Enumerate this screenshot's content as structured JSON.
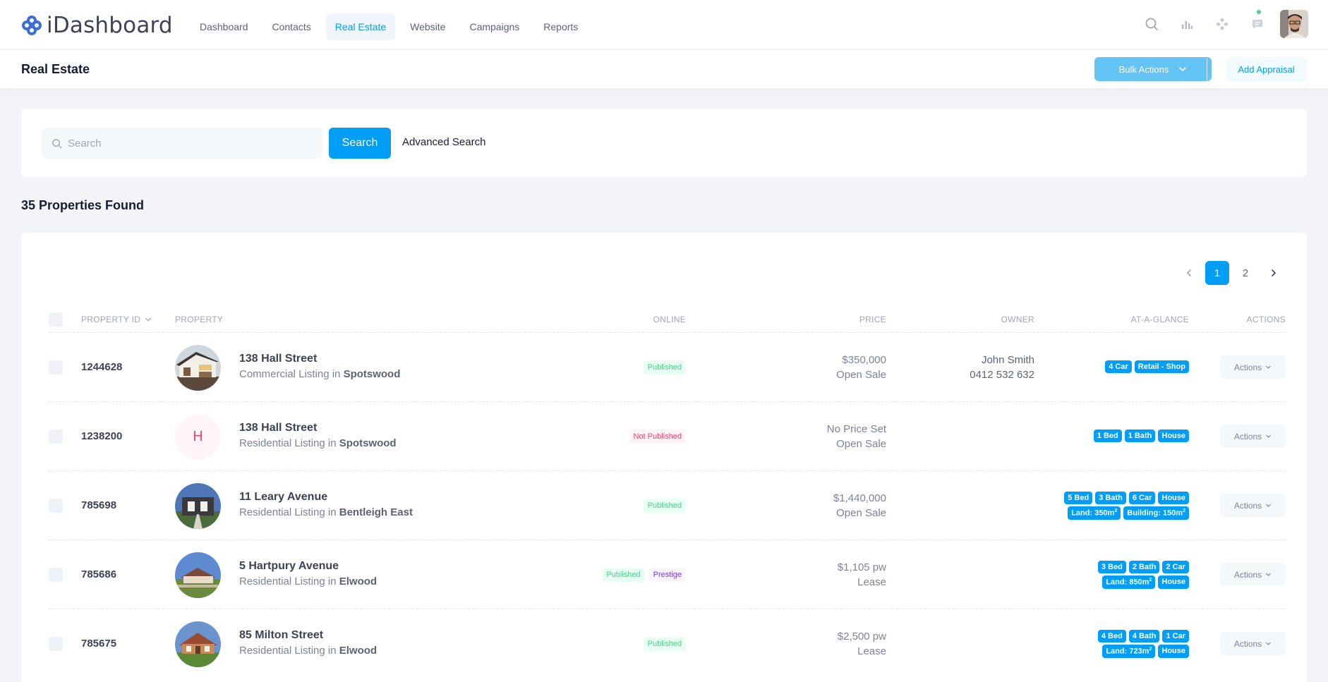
{
  "app": {
    "name": "iDashboard"
  },
  "nav": {
    "items": [
      {
        "label": "Dashboard",
        "active": false
      },
      {
        "label": "Contacts",
        "active": false
      },
      {
        "label": "Real Estate",
        "active": true
      },
      {
        "label": "Website",
        "active": false
      },
      {
        "label": "Campaigns",
        "active": false
      },
      {
        "label": "Reports",
        "active": false
      }
    ]
  },
  "toolbar": {
    "title": "Real Estate",
    "bulk_label": "Bulk Actions",
    "appraisal_label": "Add Appraisal"
  },
  "search": {
    "placeholder": "Search",
    "value": "",
    "button_label": "Search",
    "advanced_label": "Advanced Search"
  },
  "results": {
    "summary": "35 Properties Found"
  },
  "pagination": {
    "pages": [
      "1",
      "2"
    ],
    "current": "1"
  },
  "table": {
    "headers": {
      "id": "Property ID",
      "property": "Property",
      "online": "Online",
      "price": "Price",
      "owner": "Owner",
      "glance": "At-A-Glance",
      "actions": "Actions"
    },
    "rows": [
      {
        "id": "1244628",
        "address": "138 Hall Street",
        "listing": "Commercial Listing in",
        "suburb": "Spotswood",
        "thumb": "photo-1",
        "online": [
          {
            "label": "Published",
            "kind": "pub"
          }
        ],
        "price": "$350,000",
        "price_type": "Open Sale",
        "owner_name": "John Smith",
        "owner_phone": "0412 532 632",
        "glance": [
          [
            {
              "t": "4 Car"
            },
            {
              "t": "Retail - Shop"
            }
          ]
        ],
        "action_label": "Actions"
      },
      {
        "id": "1238200",
        "address": "138 Hall Street",
        "listing": "Residential Listing in",
        "suburb": "Spotswood",
        "thumb": "letter",
        "letter": "H",
        "online": [
          {
            "label": "Not Published",
            "kind": "notpub"
          }
        ],
        "price": "No Price Set",
        "price_type": "Open Sale",
        "owner_name": "",
        "owner_phone": "",
        "glance": [
          [
            {
              "t": "1 Bed"
            },
            {
              "t": "1 Bath"
            },
            {
              "t": "House"
            }
          ]
        ],
        "action_label": "Actions"
      },
      {
        "id": "785698",
        "address": "11 Leary Avenue",
        "listing": "Residential Listing in",
        "suburb": "Bentleigh East",
        "thumb": "photo-2",
        "online": [
          {
            "label": "Published",
            "kind": "pub"
          }
        ],
        "price": "$1,440,000",
        "price_type": "Open Sale",
        "owner_name": "",
        "owner_phone": "",
        "glance": [
          [
            {
              "t": "5 Bed"
            },
            {
              "t": "3 Bath"
            },
            {
              "t": "6 Car"
            },
            {
              "t": "House"
            }
          ],
          [
            {
              "t": "Land: 350m",
              "sup": "2"
            },
            {
              "t": "Building: 150m",
              "sup": "2"
            }
          ]
        ],
        "action_label": "Actions"
      },
      {
        "id": "785686",
        "address": "5 Hartpury Avenue",
        "listing": "Residential Listing in",
        "suburb": "Elwood",
        "thumb": "photo-3",
        "online": [
          {
            "label": "Published",
            "kind": "pub"
          },
          {
            "label": "Prestige",
            "kind": "prest"
          }
        ],
        "price": "$1,105 pw",
        "price_type": "Lease",
        "owner_name": "",
        "owner_phone": "",
        "glance": [
          [
            {
              "t": "3 Bed"
            },
            {
              "t": "2 Bath"
            },
            {
              "t": "2 Car"
            }
          ],
          [
            {
              "t": "Land: 850m",
              "sup": "2"
            },
            {
              "t": "House"
            }
          ]
        ],
        "action_label": "Actions"
      },
      {
        "id": "785675",
        "address": "85 Milton Street",
        "listing": "Residential Listing in",
        "suburb": "Elwood",
        "thumb": "photo-4",
        "online": [
          {
            "label": "Published",
            "kind": "pub"
          }
        ],
        "price": "$2,500 pw",
        "price_type": "Lease",
        "owner_name": "",
        "owner_phone": "",
        "glance": [
          [
            {
              "t": "4 Bed"
            },
            {
              "t": "4 Bath"
            },
            {
              "t": "1 Car"
            }
          ],
          [
            {
              "t": "Land: 723m",
              "sup": "2"
            },
            {
              "t": "House"
            }
          ]
        ],
        "action_label": "Actions"
      }
    ]
  },
  "colors": {
    "primary": "#009ef7",
    "bulk": "#63c3f5",
    "success": "#50cd89",
    "danger": "#f1416c",
    "prestige": "#7239ea"
  }
}
